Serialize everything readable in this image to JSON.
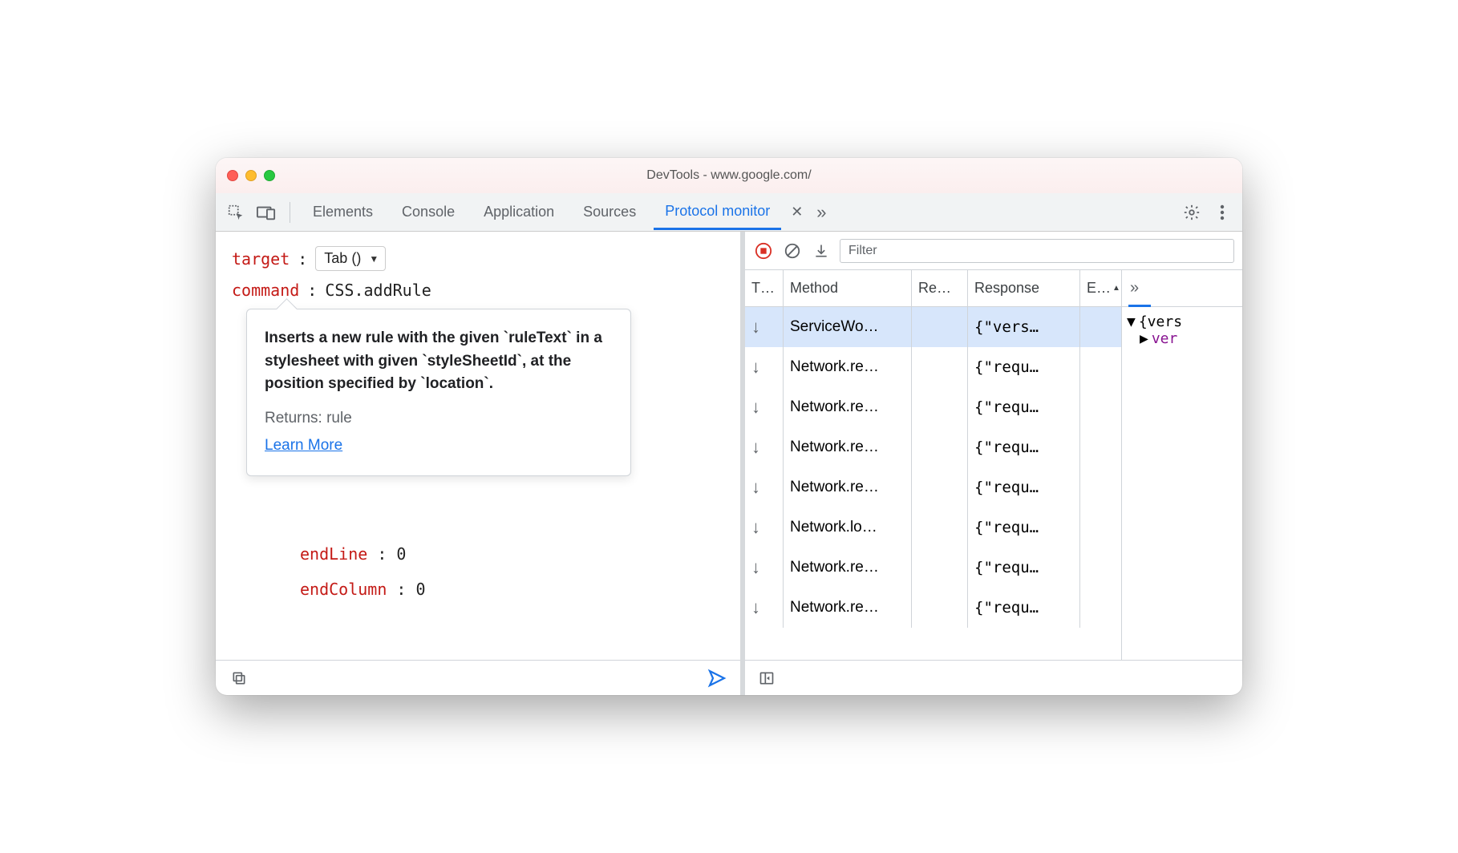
{
  "window": {
    "title": "DevTools - www.google.com/"
  },
  "tabs": {
    "items": [
      "Elements",
      "Console",
      "Application",
      "Sources",
      "Protocol monitor"
    ],
    "active_index": 4
  },
  "editor": {
    "target_label": "target",
    "target_value": "Tab ()",
    "command_label": "command",
    "command_value": "CSS.addRule",
    "tooltip": {
      "desc": "Inserts a new rule with the given `ruleText` in a stylesheet with given `styleSheetId`, at the position specified by `location`.",
      "returns": "Returns: rule",
      "link": "Learn More"
    },
    "params": [
      {
        "name": "endLine",
        "value": "0"
      },
      {
        "name": "endColumn",
        "value": "0"
      }
    ]
  },
  "monitor": {
    "filter_placeholder": "Filter",
    "columns": {
      "t": "T…",
      "method": "Method",
      "re": "Re…",
      "response": "Response",
      "e": "E…"
    },
    "rows": [
      {
        "dir": "down",
        "method": "ServiceWo…",
        "re": "",
        "response": "{\"vers…",
        "e": "",
        "selected": true
      },
      {
        "dir": "down",
        "method": "Network.re…",
        "re": "",
        "response": "{\"requ…",
        "e": ""
      },
      {
        "dir": "down",
        "method": "Network.re…",
        "re": "",
        "response": "{\"requ…",
        "e": ""
      },
      {
        "dir": "down",
        "method": "Network.re…",
        "re": "",
        "response": "{\"requ…",
        "e": ""
      },
      {
        "dir": "down",
        "method": "Network.re…",
        "re": "",
        "response": "{\"requ…",
        "e": ""
      },
      {
        "dir": "down",
        "method": "Network.lo…",
        "re": "",
        "response": "{\"requ…",
        "e": ""
      },
      {
        "dir": "down",
        "method": "Network.re…",
        "re": "",
        "response": "{\"requ…",
        "e": ""
      },
      {
        "dir": "down",
        "method": "Network.re…",
        "re": "",
        "response": "{\"requ…",
        "e": ""
      }
    ],
    "side": {
      "root": "{vers",
      "child_key": "ver"
    }
  }
}
